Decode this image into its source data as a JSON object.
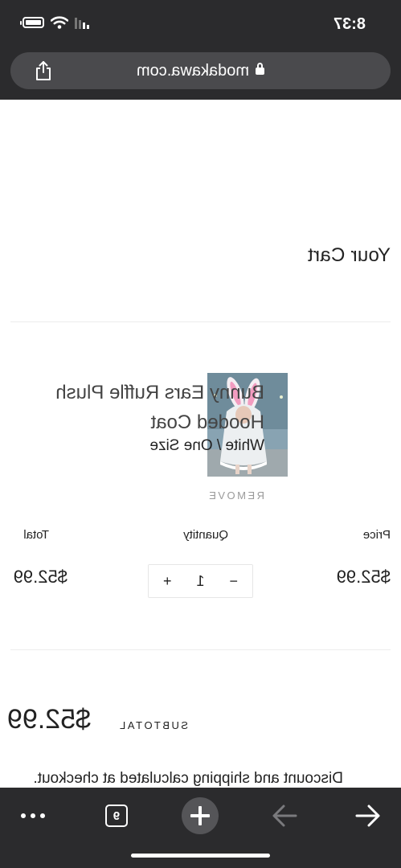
{
  "status_bar": {
    "time": "8:37"
  },
  "browser": {
    "url": "modakawa.com",
    "tab_count": "9"
  },
  "cart": {
    "title": "Your Cart",
    "item": {
      "name": "Bunny Ears Ruffle Plush Hooded Coat",
      "variant": "White / One Size",
      "remove_label": "REMOVE",
      "price_header": "Price",
      "quantity_header": "Quantity",
      "total_header": "Total",
      "price": "$52.99",
      "quantity": "1",
      "total": "$52.99",
      "minus_label": "−",
      "plus_label": "+"
    },
    "subtotal_label": "SUBTOTAL",
    "subtotal_value": "$52.99",
    "note": "Discount and shipping calculated at checkout."
  },
  "toolbar": {
    "icons": [
      "back-arrow-icon",
      "forward-arrow-icon",
      "new-tab-plus-icon",
      "tabs-icon",
      "more-dots-icon"
    ]
  },
  "colors": {
    "chrome_dark": "#2b2b2d",
    "url_bar": "#4a4a4d"
  }
}
